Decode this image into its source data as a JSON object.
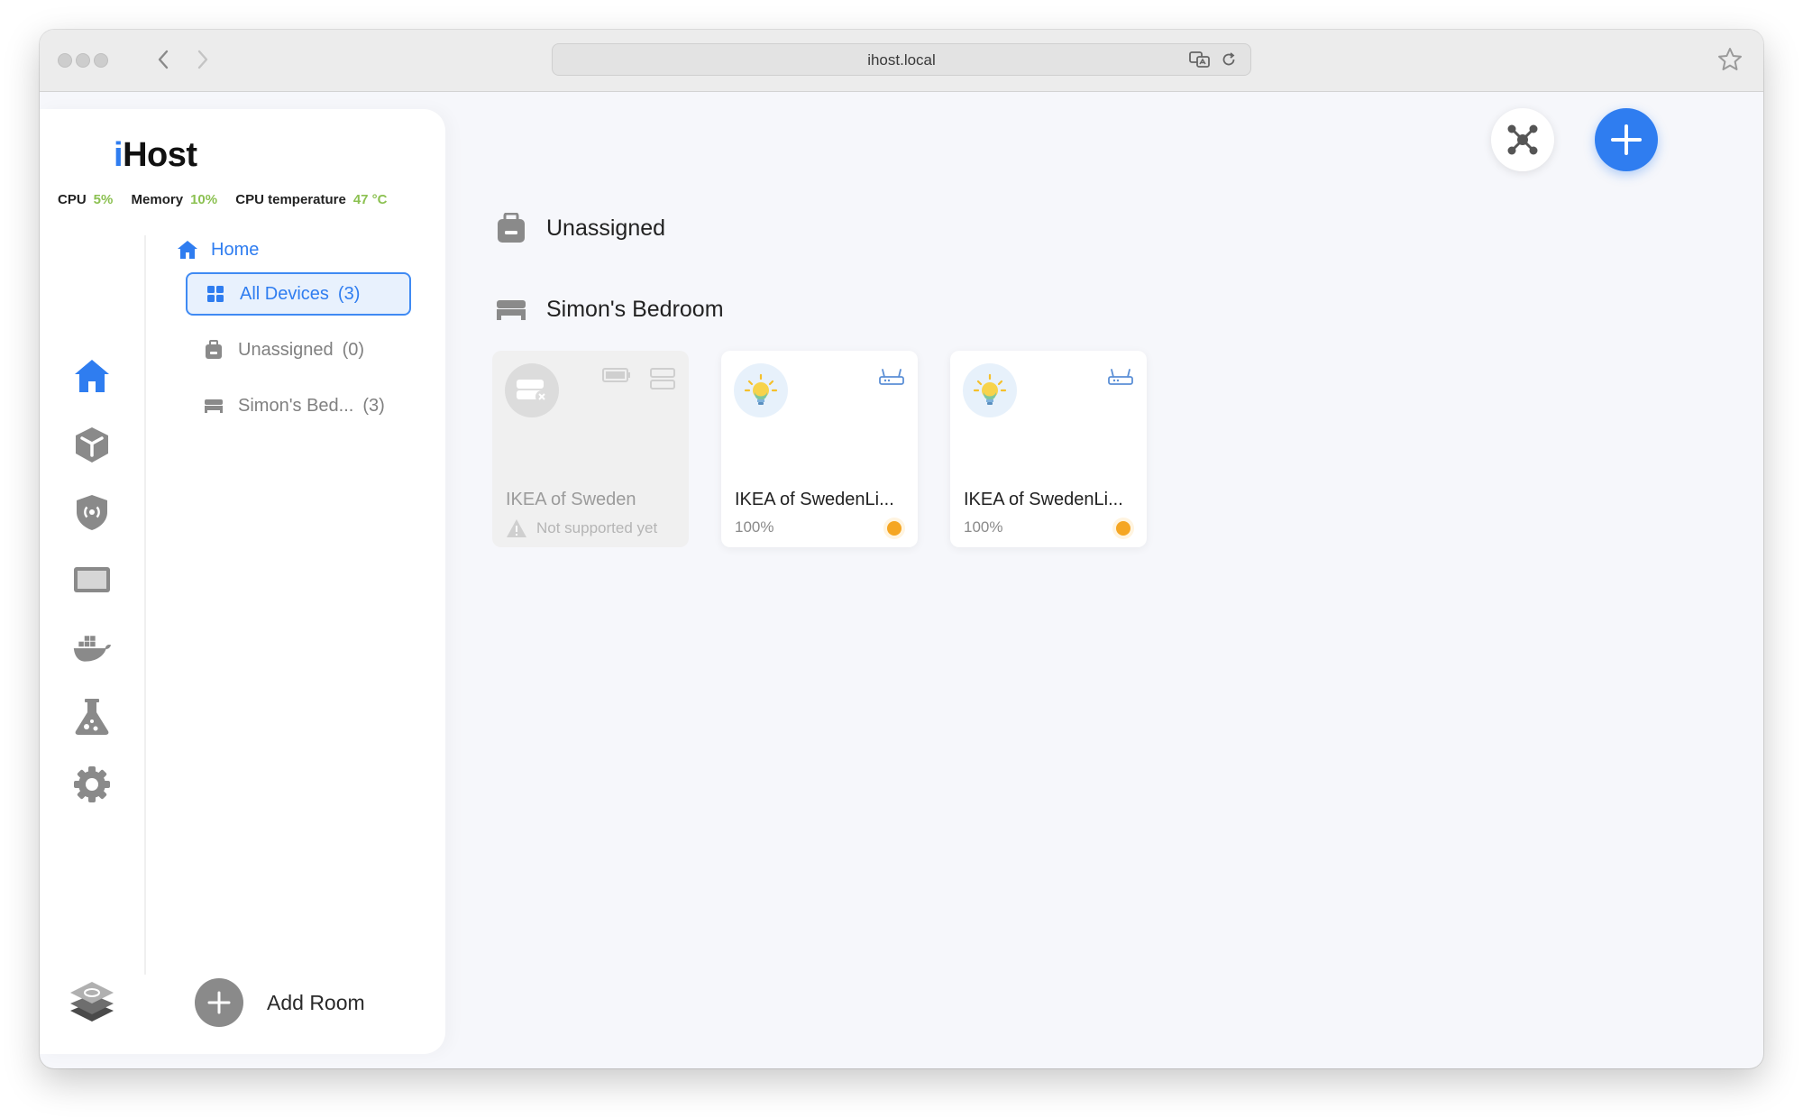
{
  "browser": {
    "url": "ihost.local"
  },
  "app": {
    "logo_i": "i",
    "logo_rest": "Host"
  },
  "stats": {
    "cpu_label": "CPU",
    "cpu_value": "5%",
    "memory_label": "Memory",
    "memory_value": "10%",
    "temp_label": "CPU temperature",
    "temp_value": "47 °C"
  },
  "tree": {
    "home_label": "Home",
    "items": [
      {
        "label": "All Devices",
        "count": "(3)",
        "active": true
      },
      {
        "label": "Unassigned",
        "count": "(0)",
        "active": false
      },
      {
        "label": "Simon's Bed...",
        "count": "(3)",
        "active": false
      }
    ],
    "add_room_label": "Add Room"
  },
  "sections": {
    "unassigned": "Unassigned",
    "bedroom": "Simon's Bedroom"
  },
  "devices": [
    {
      "name": "IKEA of Sweden",
      "status": "Not supported yet",
      "supported": false
    },
    {
      "name": "IKEA of SwedenLi...",
      "status": "100%",
      "supported": true
    },
    {
      "name": "IKEA of SwedenLi...",
      "status": "100%",
      "supported": true
    }
  ],
  "colors": {
    "accent": "#2f7df0",
    "stat_value": "#8cc152",
    "status_dot": "#f5a623"
  }
}
